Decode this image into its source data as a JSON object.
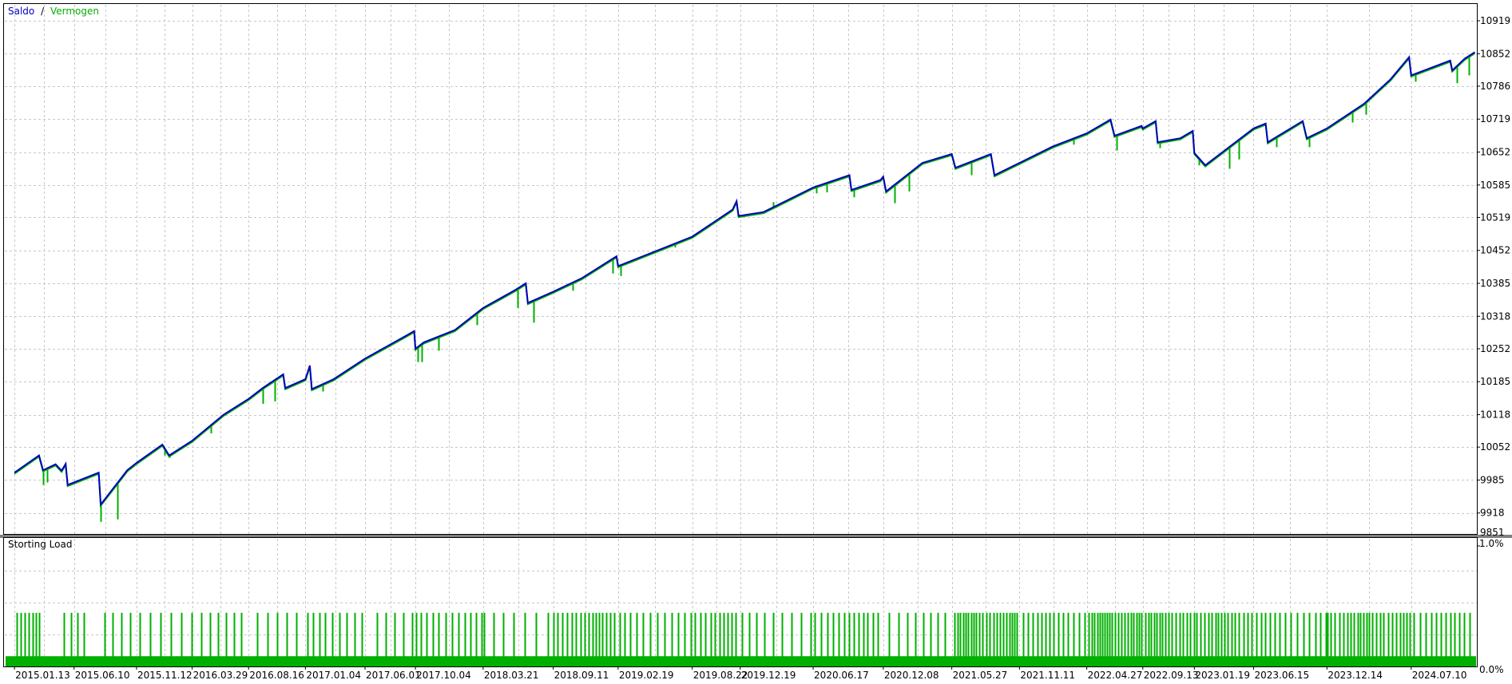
{
  "legend": {
    "balance_label": "Saldo",
    "separator": "/",
    "equity_label": "Vermogen",
    "balance_color": "#0000c0",
    "equity_color": "#00b000"
  },
  "load_panel": {
    "title": "Storting Load",
    "y_ticks": [
      "1.0%",
      "0.0%"
    ],
    "bar_color": "#00b000"
  },
  "colors": {
    "grid": "#c8c8c8",
    "axis": "#000000",
    "balance_line": "#0000c0",
    "equity_line": "#00b000",
    "separator": "#808080"
  },
  "x_ticks": [
    "2015.01.13",
    "2015.06.10",
    "2015.11.12",
    "2016.03.29",
    "2016.08.16",
    "2017.01.04",
    "2017.06.01",
    "2017.10.04",
    "2018.03.21",
    "2018.09.11",
    "2019.02.19",
    "2019.08.22",
    "2019.12.19",
    "2020.06.17",
    "2020.12.08",
    "2021.05.27",
    "2021.11.11",
    "2022.04.27",
    "2022.09.13",
    "2023.01.19",
    "2023.06.15",
    "2023.12.14",
    "2024.07.10"
  ],
  "y_ticks": [
    "10919",
    "10852",
    "10786",
    "10719",
    "10652",
    "10585",
    "10519",
    "10452",
    "10385",
    "10318",
    "10252",
    "10185",
    "10118",
    "10052",
    "9985",
    "9918",
    "9851"
  ],
  "chart_data": [
    {
      "type": "line",
      "title": "",
      "ylim": [
        9851,
        10919
      ],
      "x_tick_labels": [
        "2015.01.13",
        "2015.06.10",
        "2015.11.12",
        "2016.03.29",
        "2016.08.16",
        "2017.01.04",
        "2017.06.01",
        "2017.10.04",
        "2018.03.21",
        "2018.09.11",
        "2019.02.19",
        "2019.08.22",
        "2019.12.19",
        "2020.06.17",
        "2020.12.08",
        "2021.05.27",
        "2021.11.11",
        "2022.04.27",
        "2022.09.13",
        "2023.01.19",
        "2023.06.15",
        "2023.12.14",
        "2024.07.10"
      ],
      "series": [
        {
          "name": "Saldo",
          "points": [
            [
              "2015.01.13",
              10000
            ],
            [
              "2015.03.15",
              10035
            ],
            [
              "2015.03.25",
              10005
            ],
            [
              "2015.04.25",
              10017
            ],
            [
              "2015.05.10",
              10004
            ],
            [
              "2015.05.20",
              10018
            ],
            [
              "2015.05.25",
              9975
            ],
            [
              "2015.08.10",
              10000
            ],
            [
              "2015.08.15",
              9935
            ],
            [
              "2015.10.20",
              10005
            ],
            [
              "2015.11.12",
              10020
            ],
            [
              "2016.01.15",
              10057
            ],
            [
              "2016.02.01",
              10035
            ],
            [
              "2016.03.29",
              10065
            ],
            [
              "2016.06.15",
              10118
            ],
            [
              "2016.08.16",
              10150
            ],
            [
              "2016.09.20",
              10172
            ],
            [
              "2016.11.10",
              10200
            ],
            [
              "2016.11.15",
              10172
            ],
            [
              "2017.01.04",
              10190
            ],
            [
              "2017.01.15",
              10218
            ],
            [
              "2017.01.20",
              10170
            ],
            [
              "2017.03.15",
              10190
            ],
            [
              "2017.06.01",
              10232
            ],
            [
              "2017.09.10",
              10278
            ],
            [
              "2017.10.01",
              10288
            ],
            [
              "2017.10.04",
              10252
            ],
            [
              "2017.10.25",
              10265
            ],
            [
              "2018.01.10",
              10290
            ],
            [
              "2018.03.21",
              10335
            ],
            [
              "2018.06.10",
              10372
            ],
            [
              "2018.07.05",
              10385
            ],
            [
              "2018.07.10",
              10345
            ],
            [
              "2018.09.11",
              10368
            ],
            [
              "2018.11.20",
              10395
            ],
            [
              "2019.02.15",
              10440
            ],
            [
              "2019.02.19",
              10420
            ],
            [
              "2019.08.22",
              10480
            ],
            [
              "2019.11.30",
              10535
            ],
            [
              "2019.12.10",
              10552
            ],
            [
              "2019.12.15",
              10522
            ],
            [
              "2020.02.15",
              10530
            ],
            [
              "2020.06.17",
              10580
            ],
            [
              "2020.09.15",
              10605
            ],
            [
              "2020.09.20",
              10575
            ],
            [
              "2020.12.01",
              10595
            ],
            [
              "2020.12.08",
              10602
            ],
            [
              "2020.12.15",
              10572
            ],
            [
              "2021.03.15",
              10630
            ],
            [
              "2021.05.27",
              10648
            ],
            [
              "2021.06.05",
              10620
            ],
            [
              "2021.09.01",
              10648
            ],
            [
              "2021.09.10",
              10605
            ],
            [
              "2021.11.11",
              10630
            ],
            [
              "2022.02.01",
              10663
            ],
            [
              "2022.04.27",
              10690
            ],
            [
              "2022.06.25",
              10718
            ],
            [
              "2022.07.05",
              10685
            ],
            [
              "2022.09.10",
              10705
            ],
            [
              "2022.09.13",
              10700
            ],
            [
              "2022.10.15",
              10715
            ],
            [
              "2022.10.20",
              10672
            ],
            [
              "2022.12.15",
              10680
            ],
            [
              "2023.01.15",
              10695
            ],
            [
              "2023.01.19",
              10650
            ],
            [
              "2023.02.15",
              10625
            ],
            [
              "2023.04.20",
              10665
            ],
            [
              "2023.06.15",
              10700
            ],
            [
              "2023.07.15",
              10710
            ],
            [
              "2023.07.20",
              10672
            ],
            [
              "2023.10.15",
              10715
            ],
            [
              "2023.10.25",
              10680
            ],
            [
              "2023.12.14",
              10700
            ],
            [
              "2024.03.15",
              10750
            ],
            [
              "2024.05.20",
              10800
            ],
            [
              "2024.07.05",
              10845
            ],
            [
              "2024.07.10",
              10808
            ],
            [
              "2024.10.15",
              10838
            ],
            [
              "2024.10.20",
              10818
            ],
            [
              "2024.11.20",
              10842
            ],
            [
              "2024.12.15",
              10855
            ]
          ]
        },
        {
          "name": "Vermogen",
          "dips": [
            [
              "2015.03.25",
              9975
            ],
            [
              "2015.04.05",
              9980
            ],
            [
              "2015.08.15",
              9900
            ],
            [
              "2015.09.25",
              9905
            ],
            [
              "2016.01.20",
              10035
            ],
            [
              "2016.02.01",
              10030
            ],
            [
              "2016.02.10",
              10040
            ],
            [
              "2016.05.15",
              10080
            ],
            [
              "2016.09.20",
              10140
            ],
            [
              "2016.10.20",
              10145
            ],
            [
              "2017.02.15",
              10165
            ],
            [
              "2017.10.10",
              10225
            ],
            [
              "2017.10.20",
              10225
            ],
            [
              "2017.12.01",
              10248
            ],
            [
              "2018.03.05",
              10300
            ],
            [
              "2018.06.15",
              10335
            ],
            [
              "2018.07.25",
              10305
            ],
            [
              "2018.10.30",
              10370
            ],
            [
              "2019.02.05",
              10405
            ],
            [
              "2019.02.25",
              10400
            ],
            [
              "2019.07.10",
              10458
            ],
            [
              "2019.12.15",
              10525
            ],
            [
              "2020.03.10",
              10550
            ],
            [
              "2020.06.25",
              10568
            ],
            [
              "2020.07.20",
              10570
            ],
            [
              "2020.09.25",
              10560
            ],
            [
              "2021.01.05",
              10548
            ],
            [
              "2021.02.10",
              10572
            ],
            [
              "2021.07.15",
              10605
            ],
            [
              "2021.10.10",
              10617
            ],
            [
              "2022.03.25",
              10667
            ],
            [
              "2022.07.10",
              10655
            ],
            [
              "2022.10.25",
              10660
            ],
            [
              "2023.01.30",
              10625
            ],
            [
              "2023.04.15",
              10618
            ],
            [
              "2023.05.10",
              10637
            ],
            [
              "2023.08.10",
              10662
            ],
            [
              "2023.10.30",
              10662
            ],
            [
              "2024.02.15",
              10712
            ],
            [
              "2024.03.20",
              10728
            ],
            [
              "2024.07.20",
              10795
            ],
            [
              "2024.11.01",
              10792
            ],
            [
              "2024.12.01",
              10808
            ]
          ]
        }
      ]
    },
    {
      "type": "bar",
      "title": "Storting Load",
      "ylim": [
        0,
        1
      ],
      "y_unit": "%",
      "base_level": 0.08,
      "spike_level": 0.42,
      "spike_segments": [
        [
          "2015.01.13",
          "2015.03.20",
          7
        ],
        [
          "2015.05.01",
          "2015.07.15",
          4
        ],
        [
          "2015.08.20",
          "2016.08.16",
          16
        ],
        [
          "2016.08.16",
          "2017.01.04",
          5
        ],
        [
          "2017.01.04",
          "2017.06.01",
          9
        ],
        [
          "2017.07.01",
          "2017.10.04",
          5
        ],
        [
          "2017.10.04",
          "2018.03.21",
          12
        ],
        [
          "2018.03.21",
          "2018.09.11",
          7
        ],
        [
          "2018.09.11",
          "2019.02.19",
          16
        ],
        [
          "2019.02.19",
          "2019.08.22",
          12
        ],
        [
          "2019.08.22",
          "2019.12.19",
          10
        ],
        [
          "2019.12.19",
          "2020.06.17",
          9
        ],
        [
          "2020.06.17",
          "2020.12.08",
          13
        ],
        [
          "2020.12.08",
          "2021.05.27",
          8
        ],
        [
          "2021.05.27",
          "2021.11.11",
          22
        ],
        [
          "2021.11.11",
          "2022.04.27",
          14
        ],
        [
          "2022.04.27",
          "2022.09.13",
          20
        ],
        [
          "2022.09.13",
          "2023.01.19",
          16
        ],
        [
          "2023.01.19",
          "2023.06.15",
          16
        ],
        [
          "2023.06.15",
          "2023.12.14",
          14
        ],
        [
          "2023.12.14",
          "2024.07.10",
          24
        ],
        [
          "2024.07.10",
          "2024.12.15",
          12
        ]
      ]
    }
  ]
}
